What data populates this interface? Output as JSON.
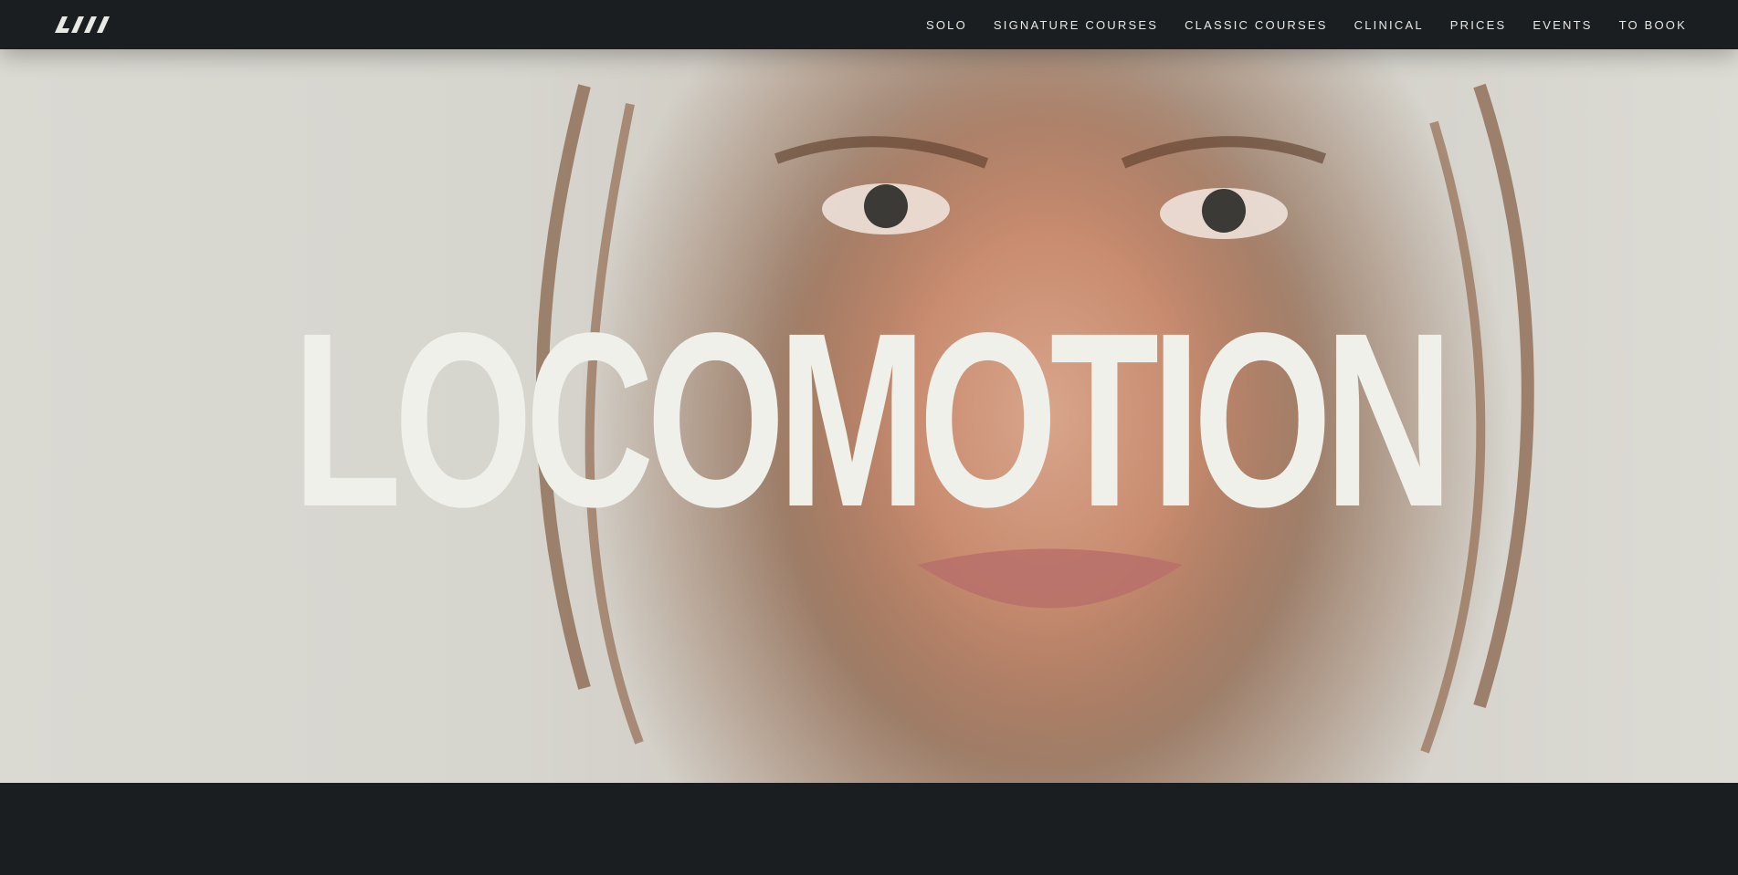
{
  "header": {
    "logo_icon": "brand-slashes-logo",
    "nav": [
      {
        "label": "SOLO"
      },
      {
        "label": "SIGNATURE COURSES"
      },
      {
        "label": "CLASSIC COURSES"
      },
      {
        "label": "CLINICAL"
      },
      {
        "label": "PRICES"
      },
      {
        "label": "EVENTS"
      },
      {
        "label": "TO BOOK"
      }
    ]
  },
  "hero": {
    "title": "LOCOMOTION",
    "image": "portrait-face-photo"
  },
  "colors": {
    "nav_bg": "#1b1e21",
    "nav_text": "#e8e8e4",
    "title_text": "#f0f0ea",
    "hero_bg": "#d8d7d0"
  }
}
